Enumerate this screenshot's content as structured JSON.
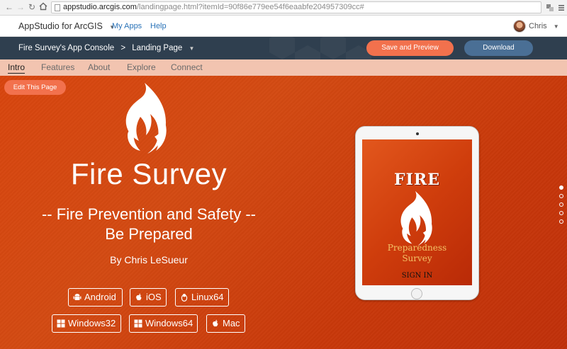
{
  "browser": {
    "url_host": "appstudio.arcgis.com",
    "url_path": "/landingpage.html?itemId=90f86e779ee54f6eaabfe204957309cc#",
    "back_icon": "arrow-left-icon",
    "forward_icon": "arrow-right-icon",
    "reload_icon": "reload-icon",
    "home_icon": "home-icon"
  },
  "header": {
    "app_title": "AppStudio for ArcGIS",
    "links": [
      "My Apps",
      "Help"
    ],
    "user_name": "Chris"
  },
  "console": {
    "breadcrumb": [
      "Fire Survey's App Console",
      "Landing Page"
    ],
    "save_label": "Save and Preview",
    "download_label": "Download"
  },
  "tabs": {
    "items": [
      "Intro",
      "Features",
      "About",
      "Explore",
      "Connect"
    ],
    "active": "Intro"
  },
  "hero": {
    "edit_label": "Edit This Page",
    "title": "Fire Survey",
    "subtitle_line1": "-- Fire Prevention and Safety --",
    "subtitle_line2": "Be Prepared",
    "author": "By Chris LeSueur",
    "platforms": [
      "Android",
      "iOS",
      "Linux64",
      "Windows32",
      "Windows64",
      "Mac"
    ]
  },
  "tablet": {
    "title": "FIRE",
    "subtitle_line1": "Preparedness",
    "subtitle_line2": "Survey",
    "signin": "SIGN IN"
  },
  "pager": {
    "count": 5,
    "active_index": 0
  },
  "colors": {
    "hero_orange": "#d34a12",
    "accent_coral": "#f2714d",
    "download_blue": "#4a6f95",
    "console_navy": "#2f3f4f",
    "tab_bar": "#f2c4b0"
  }
}
